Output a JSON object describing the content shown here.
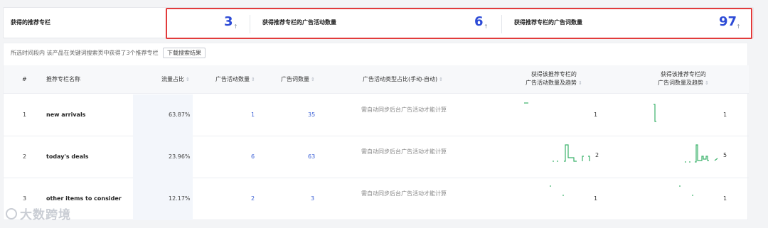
{
  "summary": {
    "label1": "获得的推荐专栏",
    "value1": "3",
    "label2": "获得推荐专栏的广告活动数量",
    "value2": "6",
    "label3": "获得推荐专栏的广告词数量",
    "value3": "97",
    "arrow_icon": "arrow-up-icon",
    "arrow_glyph": "↑",
    "highlight_color": "#e23b3b",
    "value_color": "#2d4bd6"
  },
  "info": {
    "text": "所选时间段内 该产品在关键词搜索页中获得了3个推荐专栏",
    "download_label": "下载搜索结果"
  },
  "table": {
    "headers": {
      "index": "#",
      "name": "推荐专栏名称",
      "traffic_share": "流量占比",
      "campaign_count": "广告活动数量",
      "keyword_count": "广告词数量",
      "campaign_type_share": "广告活动类型占比(手动-自动)",
      "campaign_trend_line1": "获得该推荐专栏的",
      "campaign_trend_line2": "广告活动数量及趋势",
      "keyword_trend_line1": "获得该推荐专栏的",
      "keyword_trend_line2": "广告词数量及趋势"
    },
    "sort_glyph": "⇕",
    "rows": [
      {
        "index": "1",
        "name": "new arrivals",
        "traffic_share": "63.87%",
        "campaign_count": "1",
        "keyword_count": "35",
        "type_note": "需自动同步后台广告活动才能计算",
        "campaign_trend_value": "1",
        "keyword_trend_value": "1"
      },
      {
        "index": "2",
        "name": "today's deals",
        "traffic_share": "23.96%",
        "campaign_count": "6",
        "keyword_count": "63",
        "type_note": "需自动同步后台广告活动才能计算",
        "campaign_trend_value": "2",
        "keyword_trend_value": "5"
      },
      {
        "index": "3",
        "name": "other items to consider",
        "traffic_share": "12.17%",
        "campaign_count": "2",
        "keyword_count": "3",
        "type_note": "需自动同步后台广告活动才能计算",
        "campaign_trend_value": "1",
        "keyword_trend_value": "1"
      }
    ]
  },
  "watermark": {
    "text": "大数跨境"
  },
  "trend_color": "#3bb26b"
}
